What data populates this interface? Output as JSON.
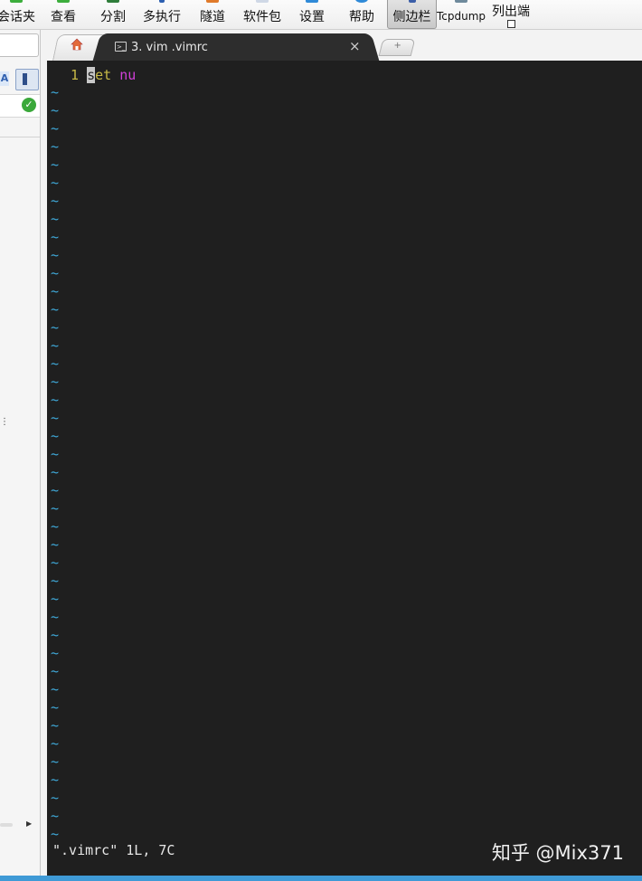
{
  "toolbar": {
    "buttons": [
      {
        "label": "会话夹",
        "icon": "star-icon"
      },
      {
        "label": "查看",
        "icon": "view-icon"
      },
      {
        "label": "分割",
        "icon": "split-icon"
      },
      {
        "label": "多执行",
        "icon": "multi-exec-icon"
      },
      {
        "label": "隧道",
        "icon": "tunnel-icon"
      },
      {
        "label": "软件包",
        "icon": "package-icon"
      },
      {
        "label": "设置",
        "icon": "gear-icon"
      },
      {
        "label": "帮助",
        "icon": "help-icon"
      },
      {
        "label": "侧边栏",
        "icon": "sidebar-icon",
        "active": true
      },
      {
        "label": "Tcpdump",
        "icon": "tcpdump-icon"
      },
      {
        "label": "列出端",
        "icon": "list-icon"
      }
    ]
  },
  "tabs": {
    "active_title": "3. vim .vimrc",
    "close_glyph": "×",
    "new_tab_glyph": "+"
  },
  "editor": {
    "line_number": "1",
    "cursor_char": "s",
    "keyword_rest": "et",
    "argument": "nu",
    "tilde": "~",
    "status": "\".vimrc\" 1L, 7C"
  },
  "watermark": "知乎 @Mix371",
  "colors": {
    "terminal_bg": "#1f1f1f",
    "tilde": "#3fa9d9",
    "line_number": "#c7b946",
    "argument": "#d040d8",
    "accent_bar": "#3f9ad6"
  }
}
